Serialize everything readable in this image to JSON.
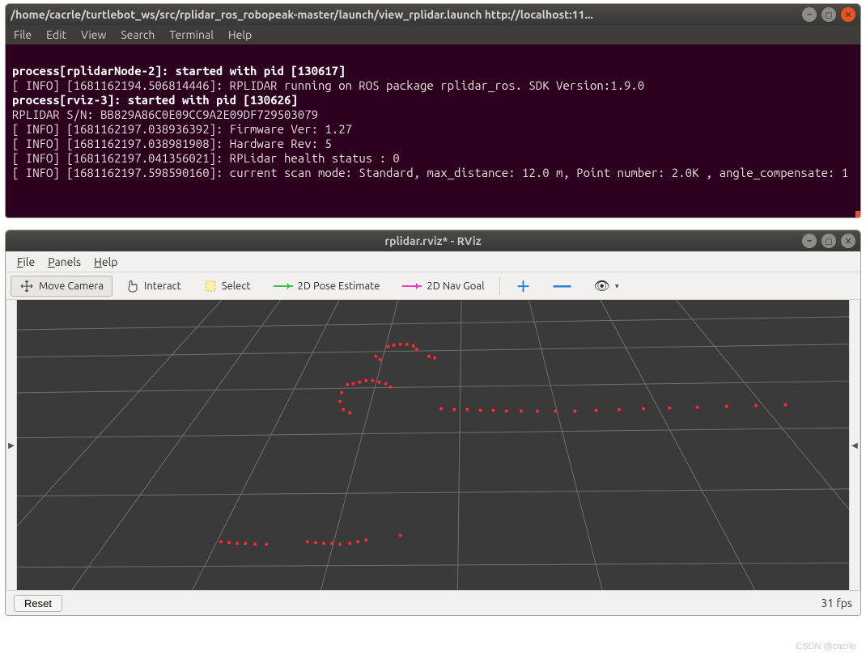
{
  "terminal": {
    "title": "/home/cacrle/turtlebot_ws/src/rplidar_ros_robopeak-master/launch/view_rplidar.launch http://localhost:11...",
    "menu": [
      "File",
      "Edit",
      "View",
      "Search",
      "Terminal",
      "Help"
    ],
    "lines": [
      {
        "bold": true,
        "text": "process[rplidarNode-2]: started with pid [130617]"
      },
      {
        "bold": false,
        "text": "[ INFO] [1681162194.506814446]: RPLIDAR running on ROS package rplidar_ros. SDK Version:1.9.0"
      },
      {
        "bold": true,
        "text": "process[rviz-3]: started with pid [130626]"
      },
      {
        "bold": false,
        "text": "RPLIDAR S/N: BB829A86C0E09CC9A2E09DF729503079"
      },
      {
        "bold": false,
        "text": "[ INFO] [1681162197.038936392]: Firmware Ver: 1.27"
      },
      {
        "bold": false,
        "text": "[ INFO] [1681162197.038981908]: Hardware Rev: 5"
      },
      {
        "bold": false,
        "text": "[ INFO] [1681162197.041356021]: RPLidar health status : 0"
      },
      {
        "bold": false,
        "text": "[ INFO] [1681162197.598590160]: current scan mode: Standard, max_distance: 12.0 m, Point number: 2.0K , angle_compensate: 1"
      }
    ]
  },
  "rviz": {
    "title": "rplidar.rviz* - RViz",
    "menu": [
      "File",
      "Panels",
      "Help"
    ],
    "tools": {
      "move_camera": "Move Camera",
      "interact": "Interact",
      "select": "Select",
      "pose_estimate": "2D Pose Estimate",
      "nav_goal": "2D Nav Goal"
    },
    "reset": "Reset",
    "fps": "31 fps"
  },
  "watermark": "CSDN @cacrle"
}
